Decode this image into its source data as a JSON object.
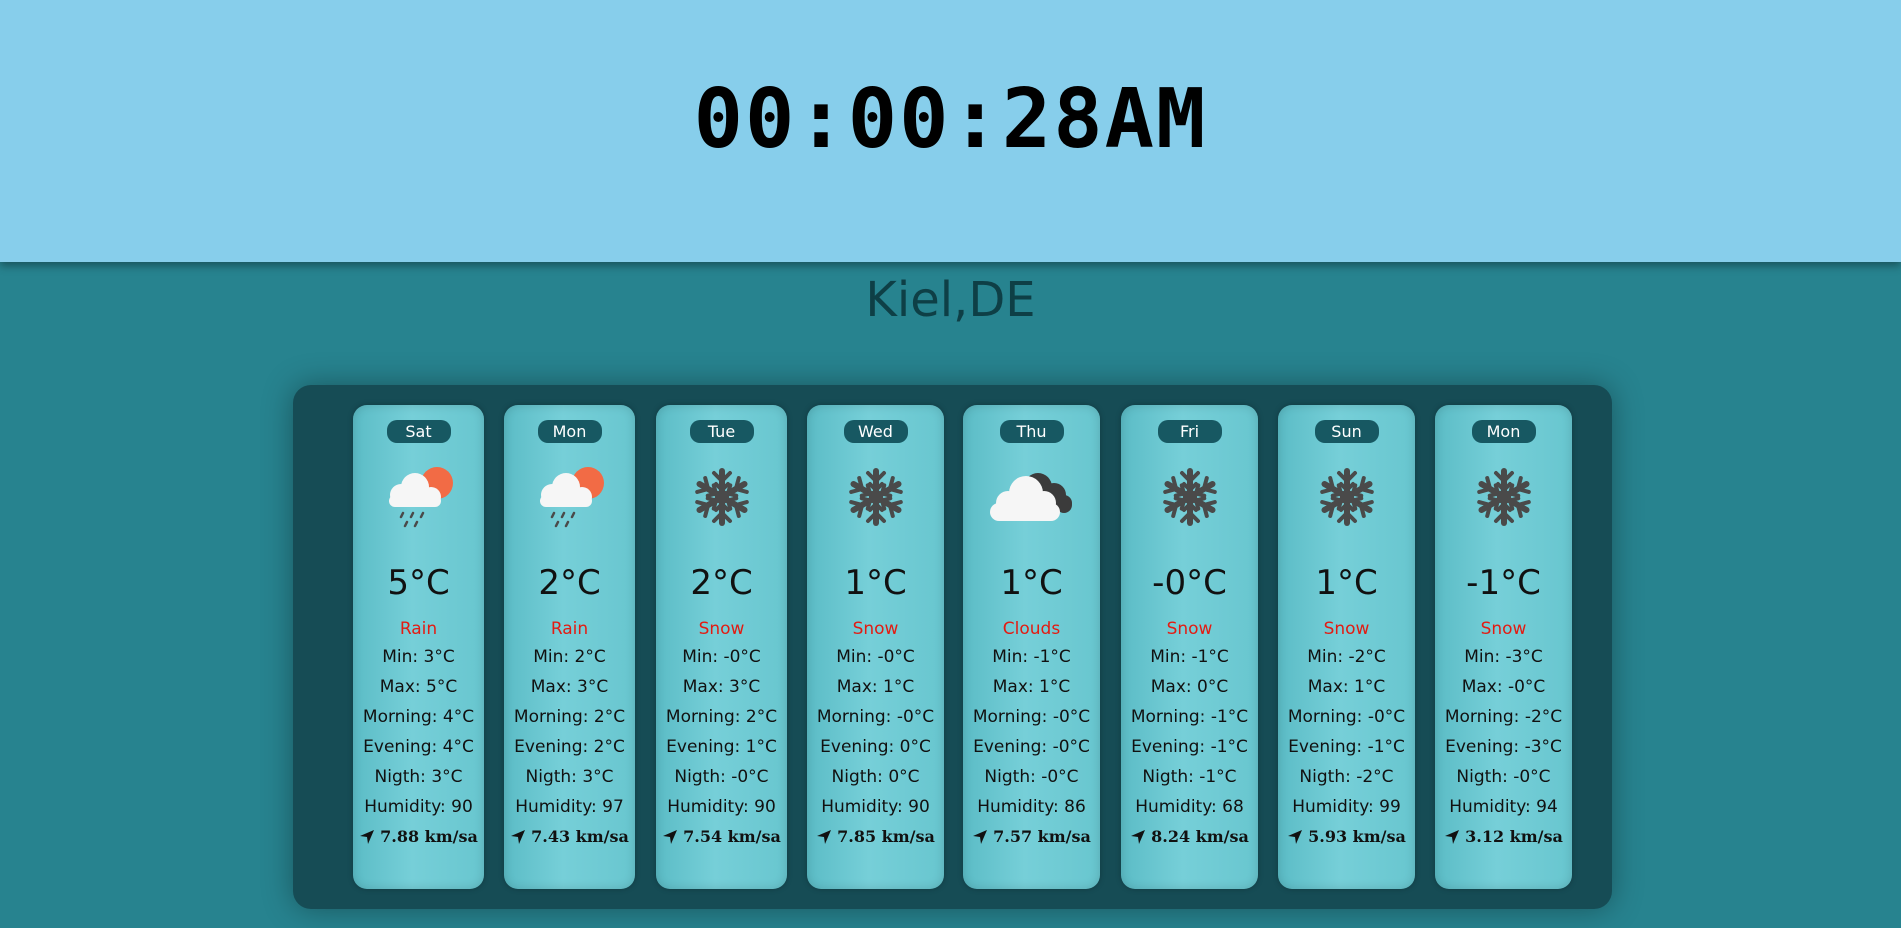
{
  "clock": "00:00:28AM",
  "city": "Kiel,DE",
  "labels": {
    "min": "Min: ",
    "max": "Max: ",
    "morning": "Morning: ",
    "evening": "Evening: ",
    "night": "Nigth: ",
    "humidity": "Humidity: ",
    "wind_unit": " km/sa"
  },
  "colors": {
    "sky": "#87ceeb",
    "background": "#27838f",
    "panel": "#164c55",
    "card": "#6fcbd4",
    "condition": "#e31b12",
    "day_badge": "#175862"
  },
  "days": [
    {
      "day": "Sat",
      "icon": "rain-sun-icon",
      "temp": "5°C",
      "desc": "Rain",
      "min": "3°C",
      "max": "5°C",
      "morning": "4°C",
      "evening": "4°C",
      "night": "3°C",
      "humidity": "90",
      "wind": "7.88"
    },
    {
      "day": "Mon",
      "icon": "rain-sun-icon",
      "temp": "2°C",
      "desc": "Rain",
      "min": "2°C",
      "max": "3°C",
      "morning": "2°C",
      "evening": "2°C",
      "night": "3°C",
      "humidity": "97",
      "wind": "7.43"
    },
    {
      "day": "Tue",
      "icon": "snowflake-icon",
      "temp": "2°C",
      "desc": "Snow",
      "min": "-0°C",
      "max": "3°C",
      "morning": "2°C",
      "evening": "1°C",
      "night": "-0°C",
      "humidity": "90",
      "wind": "7.54"
    },
    {
      "day": "Wed",
      "icon": "snowflake-icon",
      "temp": "1°C",
      "desc": "Snow",
      "min": "-0°C",
      "max": "1°C",
      "morning": "-0°C",
      "evening": "0°C",
      "night": "0°C",
      "humidity": "90",
      "wind": "7.85"
    },
    {
      "day": "Thu",
      "icon": "clouds-icon",
      "temp": "1°C",
      "desc": "Clouds",
      "min": "-1°C",
      "max": "1°C",
      "morning": "-0°C",
      "evening": "-0°C",
      "night": "-0°C",
      "humidity": "86",
      "wind": "7.57"
    },
    {
      "day": "Fri",
      "icon": "snowflake-icon",
      "temp": "-0°C",
      "desc": "Snow",
      "min": "-1°C",
      "max": "0°C",
      "morning": "-1°C",
      "evening": "-1°C",
      "night": "-1°C",
      "humidity": "68",
      "wind": "8.24"
    },
    {
      "day": "Sun",
      "icon": "snowflake-icon",
      "temp": "1°C",
      "desc": "Snow",
      "min": "-2°C",
      "max": "1°C",
      "morning": "-0°C",
      "evening": "-1°C",
      "night": "-2°C",
      "humidity": "99",
      "wind": "5.93"
    },
    {
      "day": "Mon",
      "icon": "snowflake-icon",
      "temp": "-1°C",
      "desc": "Snow",
      "min": "-3°C",
      "max": "-0°C",
      "morning": "-2°C",
      "evening": "-3°C",
      "night": "-0°C",
      "humidity": "94",
      "wind": "3.12"
    }
  ]
}
